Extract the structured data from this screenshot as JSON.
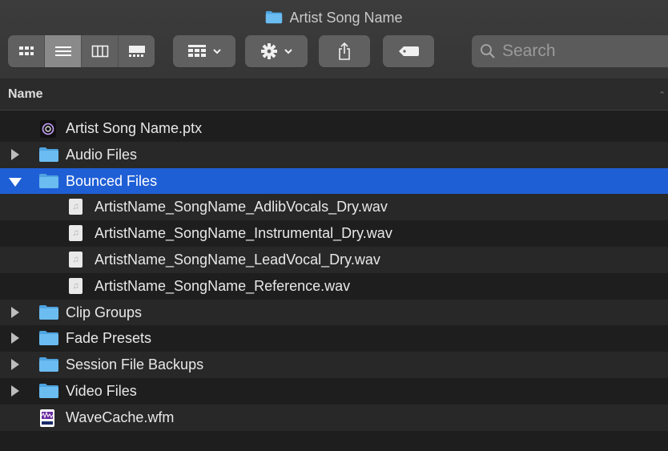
{
  "window": {
    "title": "Artist Song Name"
  },
  "toolbar": {
    "view_modes": [
      "icon-view",
      "list-view",
      "column-view",
      "gallery-view"
    ],
    "active_view": 1,
    "group_icon": "grid-group-icon",
    "action_icon": "gear-icon",
    "share_icon": "share-icon",
    "tag_icon": "tag-icon"
  },
  "search": {
    "placeholder": "Search",
    "value": ""
  },
  "columns": {
    "name": "Name"
  },
  "files": [
    {
      "label": "Artist Song Name.ptx",
      "kind": "ptx",
      "indent": 0,
      "disclosure": "none"
    },
    {
      "label": "Audio Files",
      "kind": "folder",
      "indent": 0,
      "disclosure": "collapsed"
    },
    {
      "label": "Bounced Files",
      "kind": "folder",
      "indent": 0,
      "disclosure": "expanded",
      "selected": true
    },
    {
      "label": "ArtistName_SongName_AdlibVocals_Dry.wav",
      "kind": "wav",
      "indent": 1,
      "disclosure": "none"
    },
    {
      "label": "ArtistName_SongName_Instrumental_Dry.wav",
      "kind": "wav",
      "indent": 1,
      "disclosure": "none"
    },
    {
      "label": "ArtistName_SongName_LeadVocal_Dry.wav",
      "kind": "wav",
      "indent": 1,
      "disclosure": "none"
    },
    {
      "label": "ArtistName_SongName_Reference.wav",
      "kind": "wav",
      "indent": 1,
      "disclosure": "none"
    },
    {
      "label": "Clip Groups",
      "kind": "folder",
      "indent": 0,
      "disclosure": "collapsed"
    },
    {
      "label": "Fade Presets",
      "kind": "folder",
      "indent": 0,
      "disclosure": "collapsed"
    },
    {
      "label": "Session File Backups",
      "kind": "folder",
      "indent": 0,
      "disclosure": "collapsed"
    },
    {
      "label": "Video Files",
      "kind": "folder",
      "indent": 0,
      "disclosure": "collapsed"
    },
    {
      "label": "WaveCache.wfm",
      "kind": "wfm",
      "indent": 0,
      "disclosure": "none"
    }
  ],
  "colors": {
    "selection": "#1f5fd6",
    "folder": "#5fb3e8"
  }
}
